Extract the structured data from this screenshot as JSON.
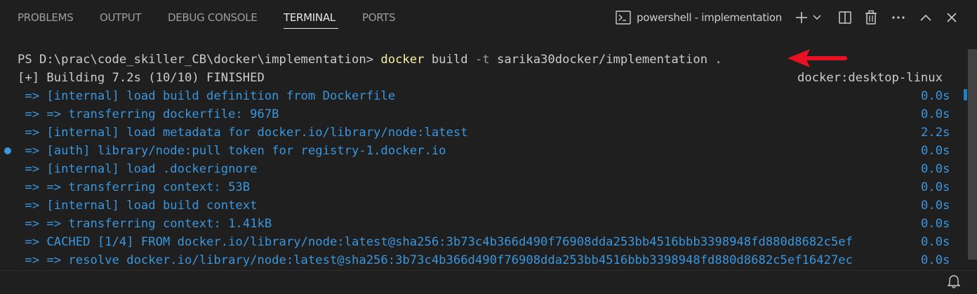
{
  "panel": {
    "tabs": [
      {
        "label": "PROBLEMS"
      },
      {
        "label": "OUTPUT"
      },
      {
        "label": "DEBUG CONSOLE"
      },
      {
        "label": "TERMINAL"
      },
      {
        "label": "PORTS"
      }
    ],
    "active_tab": "TERMINAL",
    "terminal_name": "powershell - implementation"
  },
  "terminal": {
    "prompt": "PS D:\\prac\\code_skiller_CB\\docker\\implementation> ",
    "command": "docker",
    "args_1": " build ",
    "flag": "-t",
    "args_2": " sarika30docker/implementation .",
    "build_status": "[+] Building 7.2s (10/10) FINISHED",
    "builder": "docker:desktop-linux",
    "steps": [
      {
        "text": " => [internal] load build definition from Dockerfile",
        "time": "0.0s"
      },
      {
        "text": " => => transferring dockerfile: 967B",
        "time": "0.0s"
      },
      {
        "text": " => [internal] load metadata for docker.io/library/node:latest",
        "time": "2.2s"
      },
      {
        "text": " => [auth] library/node:pull token for registry-1.docker.io",
        "time": "0.0s"
      },
      {
        "text": " => [internal] load .dockerignore",
        "time": "0.0s"
      },
      {
        "text": " => => transferring context: 53B",
        "time": "0.0s"
      },
      {
        "text": " => [internal] load build context",
        "time": "0.0s"
      },
      {
        "text": " => => transferring context: 1.41kB",
        "time": "0.0s"
      },
      {
        "text": " => CACHED [1/4] FROM docker.io/library/node:latest@sha256:3b73c4b366d490f76908dda253bb4516bbb3398948fd880d8682c5ef",
        "time": "0.0s"
      },
      {
        "text": " => => resolve docker.io/library/node:latest@sha256:3b73c4b366d490f76908dda253bb4516bbb3398948fd880d8682c5ef16427ec",
        "time": "0.0s"
      }
    ]
  },
  "colors": {
    "background": "#1f1f1f",
    "step_text": "#3a96dd",
    "command": "#f9f1a5",
    "annotation_arrow": "#e81123"
  },
  "icons": [
    "terminal-icon",
    "plus-icon",
    "chevron-down-icon",
    "split-icon",
    "trash-icon",
    "more-icon",
    "chevron-up-icon",
    "close-icon",
    "bell-icon",
    "arrow-annotation"
  ]
}
